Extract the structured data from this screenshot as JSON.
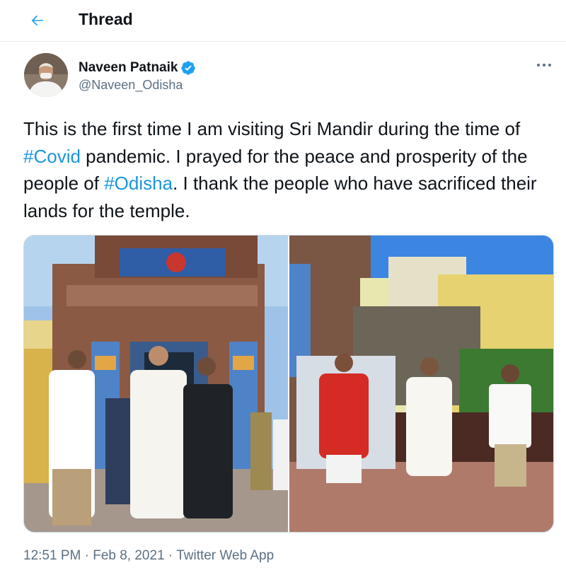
{
  "header": {
    "title": "Thread",
    "back_icon": "back-arrow-icon"
  },
  "author": {
    "name": "Naveen Patnaik",
    "handle": "@Naveen_Odisha",
    "verified_icon": "verified-badge-icon"
  },
  "tweet": {
    "segments": [
      {
        "text": "This is the first time I am visiting Sri Mandir during the time of ",
        "hashtag": false
      },
      {
        "text": "#Covid",
        "hashtag": true
      },
      {
        "text": " pandemic. I prayed for the peace and prosperity of the people of ",
        "hashtag": false
      },
      {
        "text": "#Odisha",
        "hashtag": true
      },
      {
        "text": ". I thank the people who have sacrificed their lands for the temple.",
        "hashtag": false
      }
    ]
  },
  "media": {
    "count": 2
  },
  "meta": {
    "time": "12:51 PM",
    "separator": " · ",
    "date": "Feb 8, 2021",
    "source": "Twitter Web App"
  },
  "colors": {
    "accent": "#1da1f2",
    "hashtag": "#1b95e0",
    "secondary_text": "#5b7083",
    "border": "#e6ecf0"
  }
}
